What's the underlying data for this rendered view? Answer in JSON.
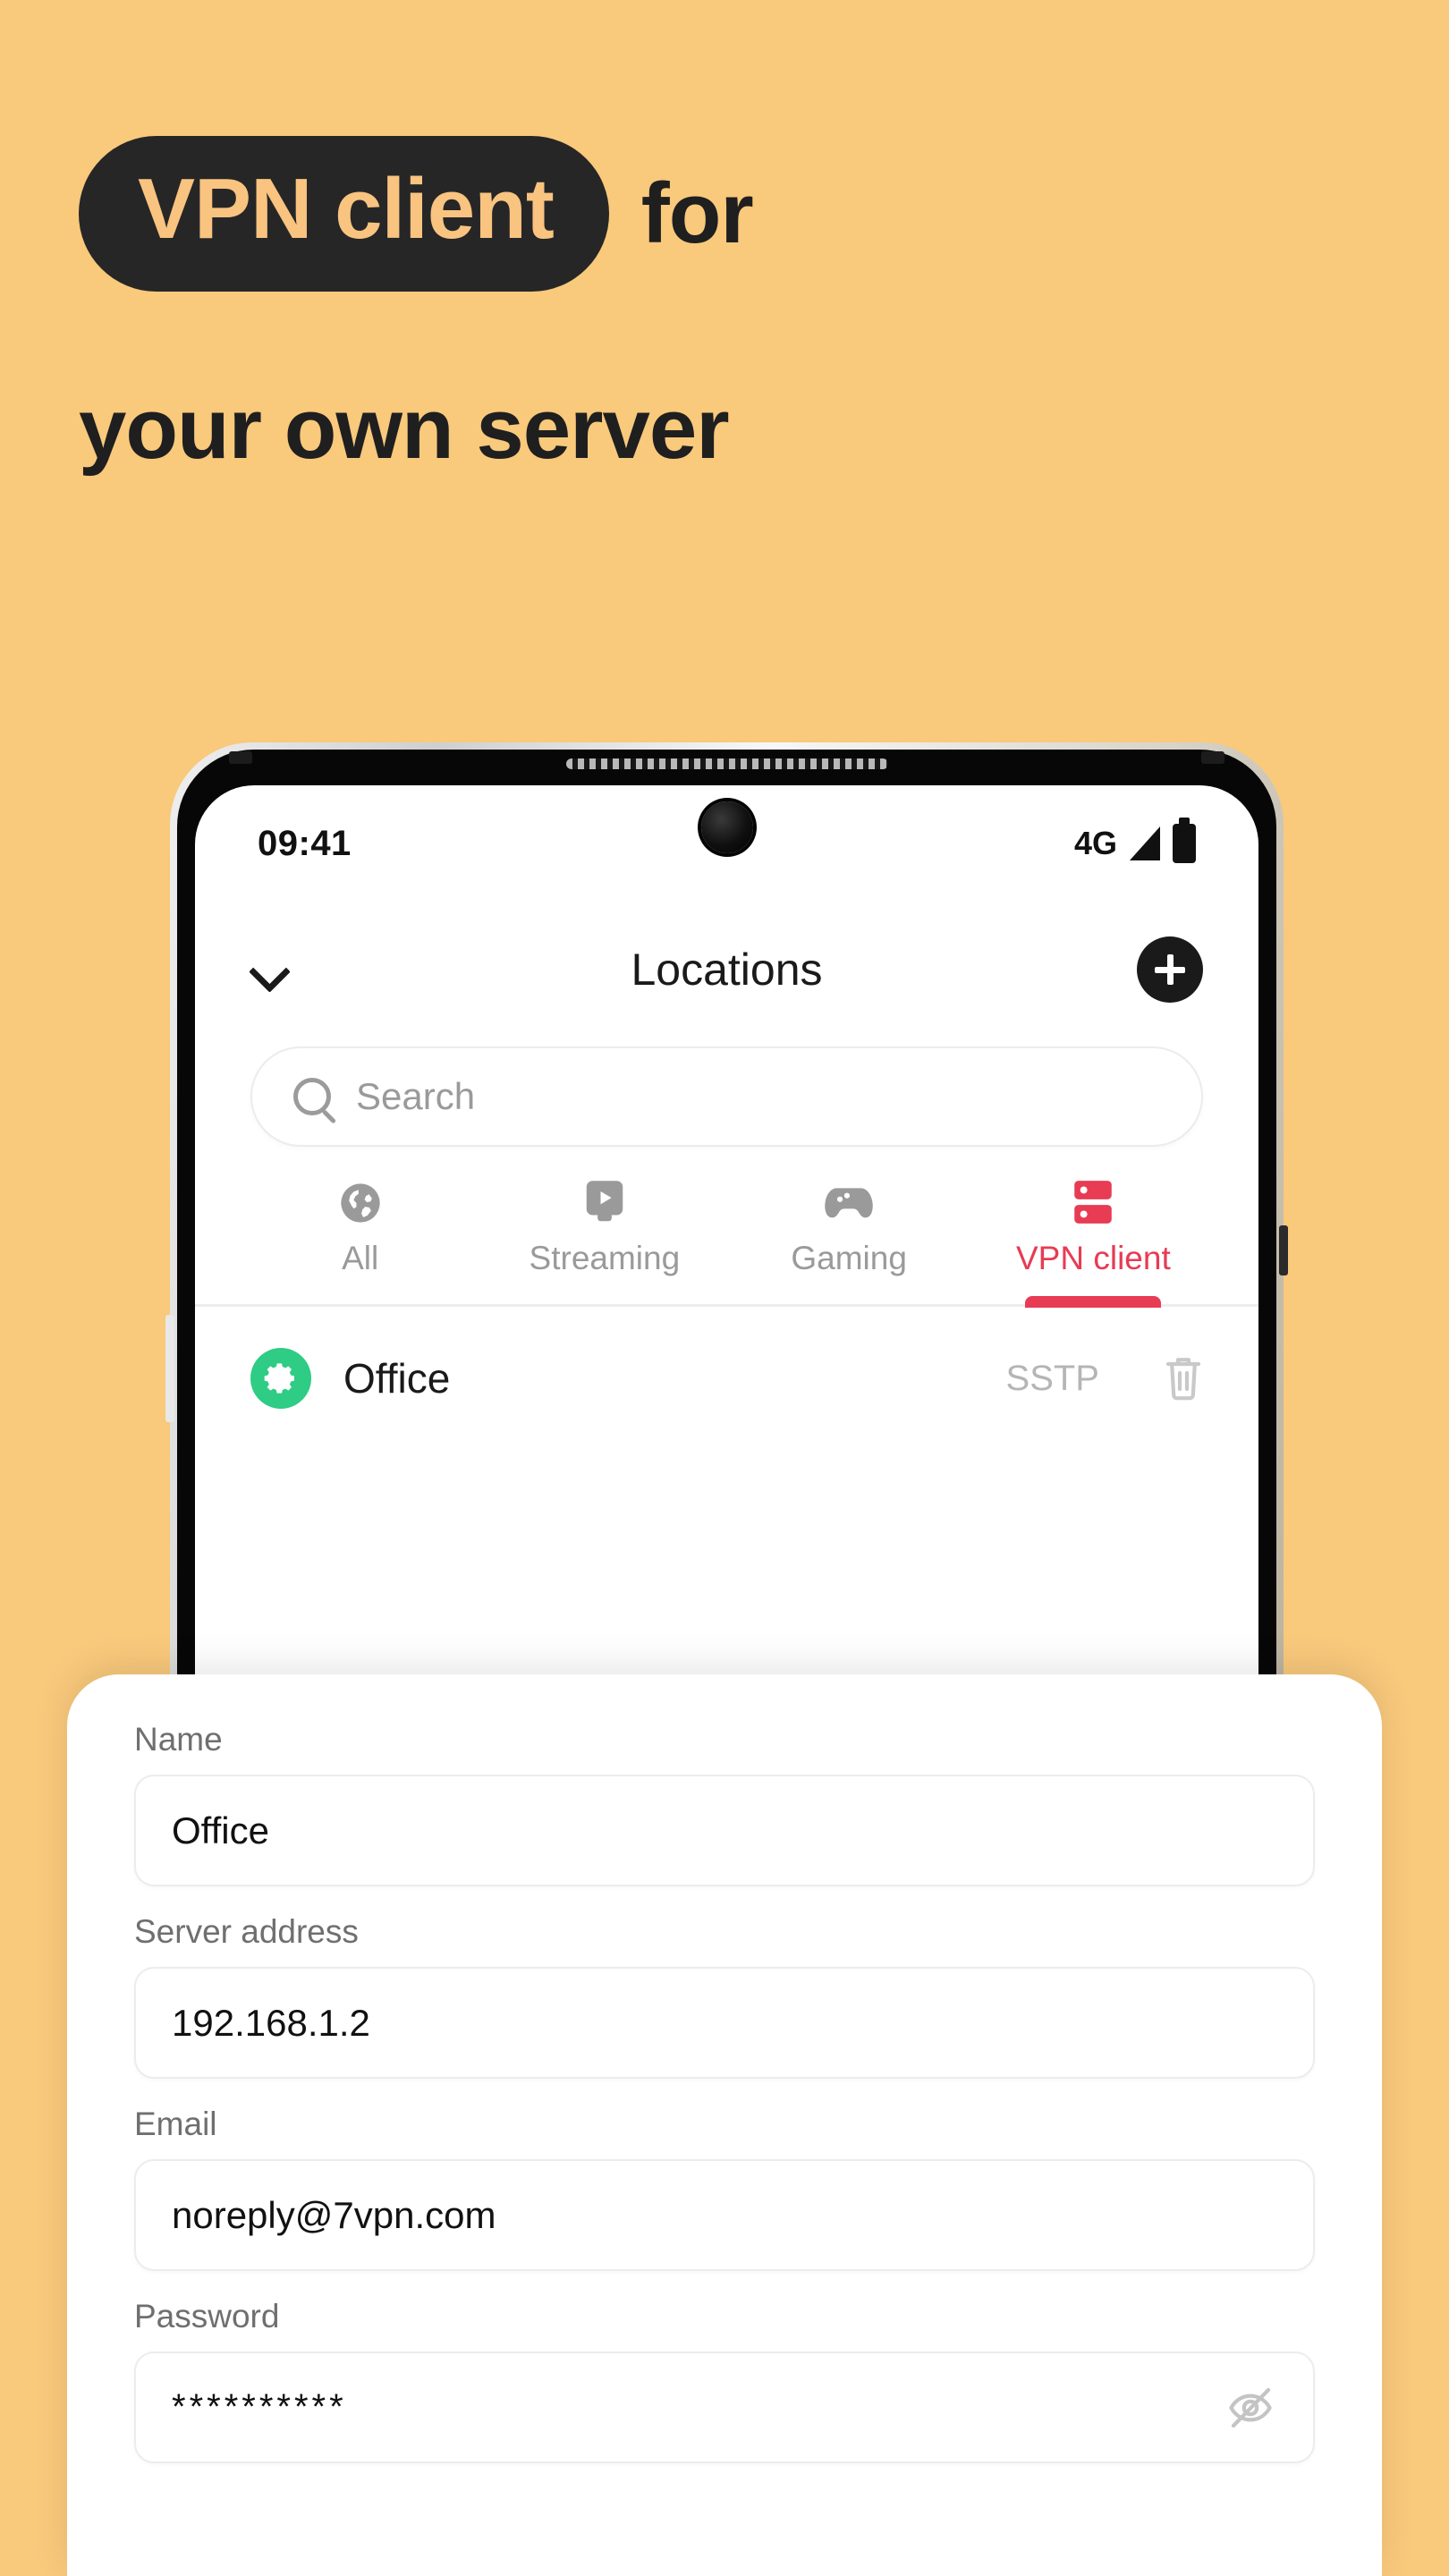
{
  "theme": {
    "background": "#F9C97C",
    "dark": "#262626",
    "accent_red": "#E83B54",
    "accent_green": "#2ECC84",
    "pill_text": "#F9C380"
  },
  "headline": {
    "pill_text": "VPN client",
    "after_pill": "for",
    "line2": "your own server"
  },
  "phone": {
    "statusbar": {
      "time": "09:41",
      "network": "4G",
      "signal_icon": "signal-triangle-icon",
      "battery_icon": "battery-full-icon",
      "camera_icon": "punch-hole-camera"
    },
    "app_header": {
      "back_icon": "chevron-down-icon",
      "title": "Locations",
      "add_icon": "plus-icon"
    },
    "search": {
      "icon": "search-icon",
      "placeholder": "Search",
      "value": ""
    },
    "tabs": [
      {
        "label": "All",
        "icon": "globe-icon",
        "active": false
      },
      {
        "label": "Streaming",
        "icon": "play-badge-icon",
        "active": false
      },
      {
        "label": "Gaming",
        "icon": "gamepad-icon",
        "active": false
      },
      {
        "label": "VPN client",
        "icon": "server-stack-icon",
        "active": true
      }
    ],
    "list": [
      {
        "status_icon": "gear-icon",
        "name": "Office",
        "protocol": "SSTP",
        "delete_icon": "trash-icon"
      }
    ]
  },
  "sheet": {
    "fields": [
      {
        "label": "Name",
        "value": "Office",
        "type": "text"
      },
      {
        "label": "Server address",
        "value": "192.168.1.2",
        "type": "text"
      },
      {
        "label": "Email",
        "value": "noreply@7vpn.com",
        "type": "text"
      },
      {
        "label": "Password",
        "value": "**********",
        "type": "password",
        "toggle_icon": "eye-off-icon"
      }
    ]
  }
}
